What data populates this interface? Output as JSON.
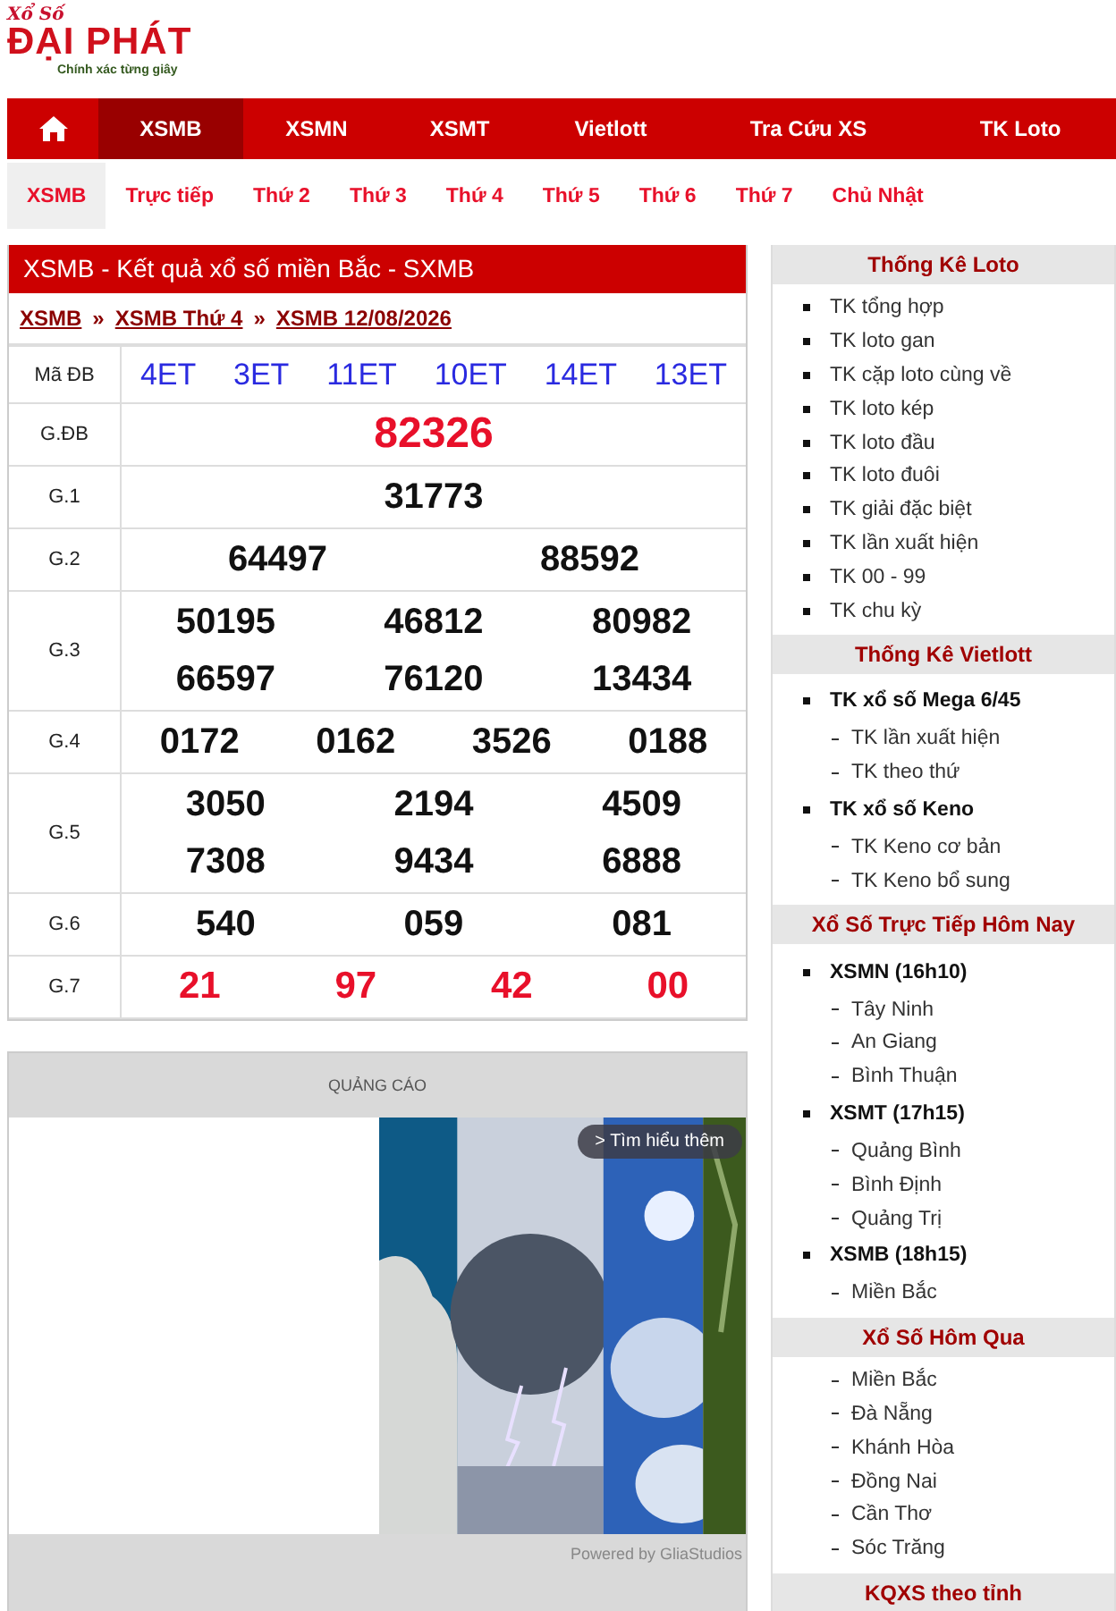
{
  "logo": {
    "script": "Xổ Số",
    "brand": "ĐẠI PHÁT",
    "tagline": "Chính xác từng giây"
  },
  "nav": [
    {
      "kind": "home",
      "selected": false
    },
    {
      "kind": "text",
      "label": "XSMB",
      "selected": true
    },
    {
      "kind": "text",
      "label": "XSMN",
      "selected": false
    },
    {
      "kind": "text",
      "label": "XSMT",
      "selected": false
    },
    {
      "kind": "text",
      "label": "Vietlott",
      "selected": false
    },
    {
      "kind": "text",
      "label": "Tra Cứu XS",
      "selected": false
    },
    {
      "kind": "text",
      "label": "TK Loto",
      "selected": false
    }
  ],
  "subnav": [
    {
      "label": "XSMB",
      "selected": true
    },
    {
      "label": "Trực tiếp",
      "selected": false
    },
    {
      "label": "Thứ 2",
      "selected": false
    },
    {
      "label": "Thứ 3",
      "selected": false
    },
    {
      "label": "Thứ 4",
      "selected": false
    },
    {
      "label": "Thứ 5",
      "selected": false
    },
    {
      "label": "Thứ 6",
      "selected": false
    },
    {
      "label": "Thứ 7",
      "selected": false
    },
    {
      "label": "Chủ Nhật",
      "selected": false
    }
  ],
  "results": {
    "title": "XSMB - Kết quả xổ số miền Bắc - SXMB",
    "breadcrumb": [
      "XSMB",
      "XSMB Thứ 4",
      "XSMB 12/08/2026"
    ],
    "separator": "»",
    "code_row": {
      "label": "Mã ĐB",
      "codes": [
        "4ET",
        "3ET",
        "11ET",
        "10ET",
        "14ET",
        "13ET"
      ]
    },
    "rows": [
      {
        "label": "G.ĐB",
        "kind": "special",
        "lines": [
          [
            "82326"
          ]
        ]
      },
      {
        "label": "G.1",
        "kind": "normal",
        "lines": [
          [
            "31773"
          ]
        ]
      },
      {
        "label": "G.2",
        "kind": "normal",
        "lines": [
          [
            "64497",
            "88592"
          ]
        ]
      },
      {
        "label": "G.3",
        "kind": "normal",
        "lines": [
          [
            "50195",
            "46812",
            "80982"
          ],
          [
            "66597",
            "76120",
            "13434"
          ]
        ]
      },
      {
        "label": "G.4",
        "kind": "normal",
        "lines": [
          [
            "0172",
            "0162",
            "3526",
            "0188"
          ]
        ]
      },
      {
        "label": "G.5",
        "kind": "normal",
        "lines": [
          [
            "3050",
            "2194",
            "4509"
          ],
          [
            "7308",
            "9434",
            "6888"
          ]
        ]
      },
      {
        "label": "G.6",
        "kind": "normal",
        "lines": [
          [
            "540",
            "059",
            "081"
          ]
        ]
      },
      {
        "label": "G.7",
        "kind": "last",
        "lines": [
          [
            "21",
            "97",
            "42",
            "00"
          ]
        ]
      }
    ]
  },
  "ad": {
    "label": "QUẢNG CÁO",
    "cta": "> Tìm hiểu thêm",
    "credit": "Powered by GliaStudios"
  },
  "sidebar": [
    {
      "title": "Thống Kê Loto",
      "items": [
        {
          "kind": "bullet",
          "label": "TK tổng hợp"
        },
        {
          "kind": "bullet",
          "label": "TK loto gan"
        },
        {
          "kind": "bullet",
          "label": "TK cặp loto cùng về"
        },
        {
          "kind": "bullet",
          "label": "TK loto kép"
        },
        {
          "kind": "bullet",
          "label": "TK loto đầu"
        },
        {
          "kind": "bullet",
          "label": "TK loto đuôi"
        },
        {
          "kind": "bullet",
          "label": "TK giải đặc biệt"
        },
        {
          "kind": "bullet",
          "label": "TK lần xuất hiện"
        },
        {
          "kind": "bullet",
          "label": "TK 00 - 99"
        },
        {
          "kind": "bullet",
          "label": "TK chu kỳ"
        }
      ]
    },
    {
      "title": "Thống Kê Vietlott",
      "items": [
        {
          "kind": "group",
          "label": "TK xổ số Mega 6/45",
          "children": [
            {
              "label": "TK lần xuất hiện"
            },
            {
              "label": "TK theo thứ"
            }
          ]
        },
        {
          "kind": "group",
          "label": "TK xổ số Keno",
          "children": [
            {
              "label": "TK Keno cơ bản"
            },
            {
              "label": "TK Keno bổ sung"
            }
          ]
        }
      ]
    },
    {
      "title": "Xổ Số Trực Tiếp Hôm Nay",
      "items": [
        {
          "kind": "group",
          "label": "XSMN (16h10)",
          "children": [
            {
              "label": "Tây Ninh"
            },
            {
              "label": "An Giang"
            },
            {
              "label": "Bình Thuận"
            }
          ]
        },
        {
          "kind": "group",
          "label": "XSMT (17h15)",
          "children": [
            {
              "label": "Quảng Bình"
            },
            {
              "label": "Bình Định"
            },
            {
              "label": "Quảng Trị"
            }
          ]
        },
        {
          "kind": "group",
          "label": "XSMB (18h15)",
          "children": [
            {
              "label": "Miền Bắc"
            }
          ]
        }
      ]
    },
    {
      "title": "Xổ Số Hôm Qua",
      "items": [
        {
          "kind": "dash",
          "label": "Miền Bắc"
        },
        {
          "kind": "dash",
          "label": "Đà Nẵng"
        },
        {
          "kind": "dash",
          "label": "Khánh Hòa"
        },
        {
          "kind": "dash",
          "label": "Đồng Nai"
        },
        {
          "kind": "dash",
          "label": "Cần Thơ"
        },
        {
          "kind": "dash",
          "label": "Sóc Trăng"
        }
      ]
    },
    {
      "title": "KQXS theo tỉnh"
    }
  ]
}
